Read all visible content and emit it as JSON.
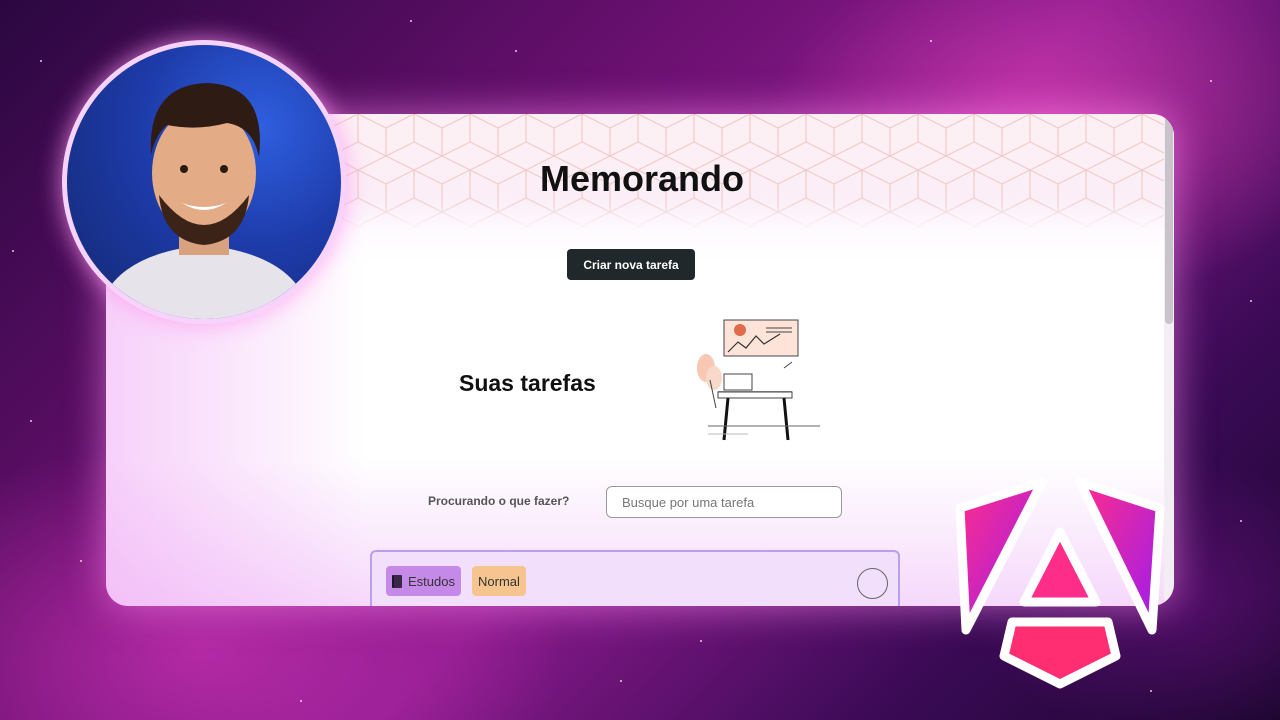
{
  "app": {
    "title": "Memorando",
    "create_button": "Criar nova tarefa",
    "section_title": "Suas tarefas",
    "search": {
      "label": "Procurando o que fazer?",
      "placeholder": "Busque por uma tarefa",
      "value": ""
    },
    "tasks": [
      {
        "category": "Estudos",
        "category_icon": "book-icon",
        "priority": "Normal",
        "done": false
      }
    ]
  },
  "colors": {
    "accent_button": "#20282b",
    "category_tag": "#c58ae8",
    "priority_tag": "#f5c48f",
    "card_border": "#b8a0ea",
    "logo_gradient_start": "#ff2d8a",
    "logo_gradient_end": "#9b1cf0"
  },
  "overlay": {
    "avatar": "presenter-photo",
    "logo": "angular-logo"
  }
}
